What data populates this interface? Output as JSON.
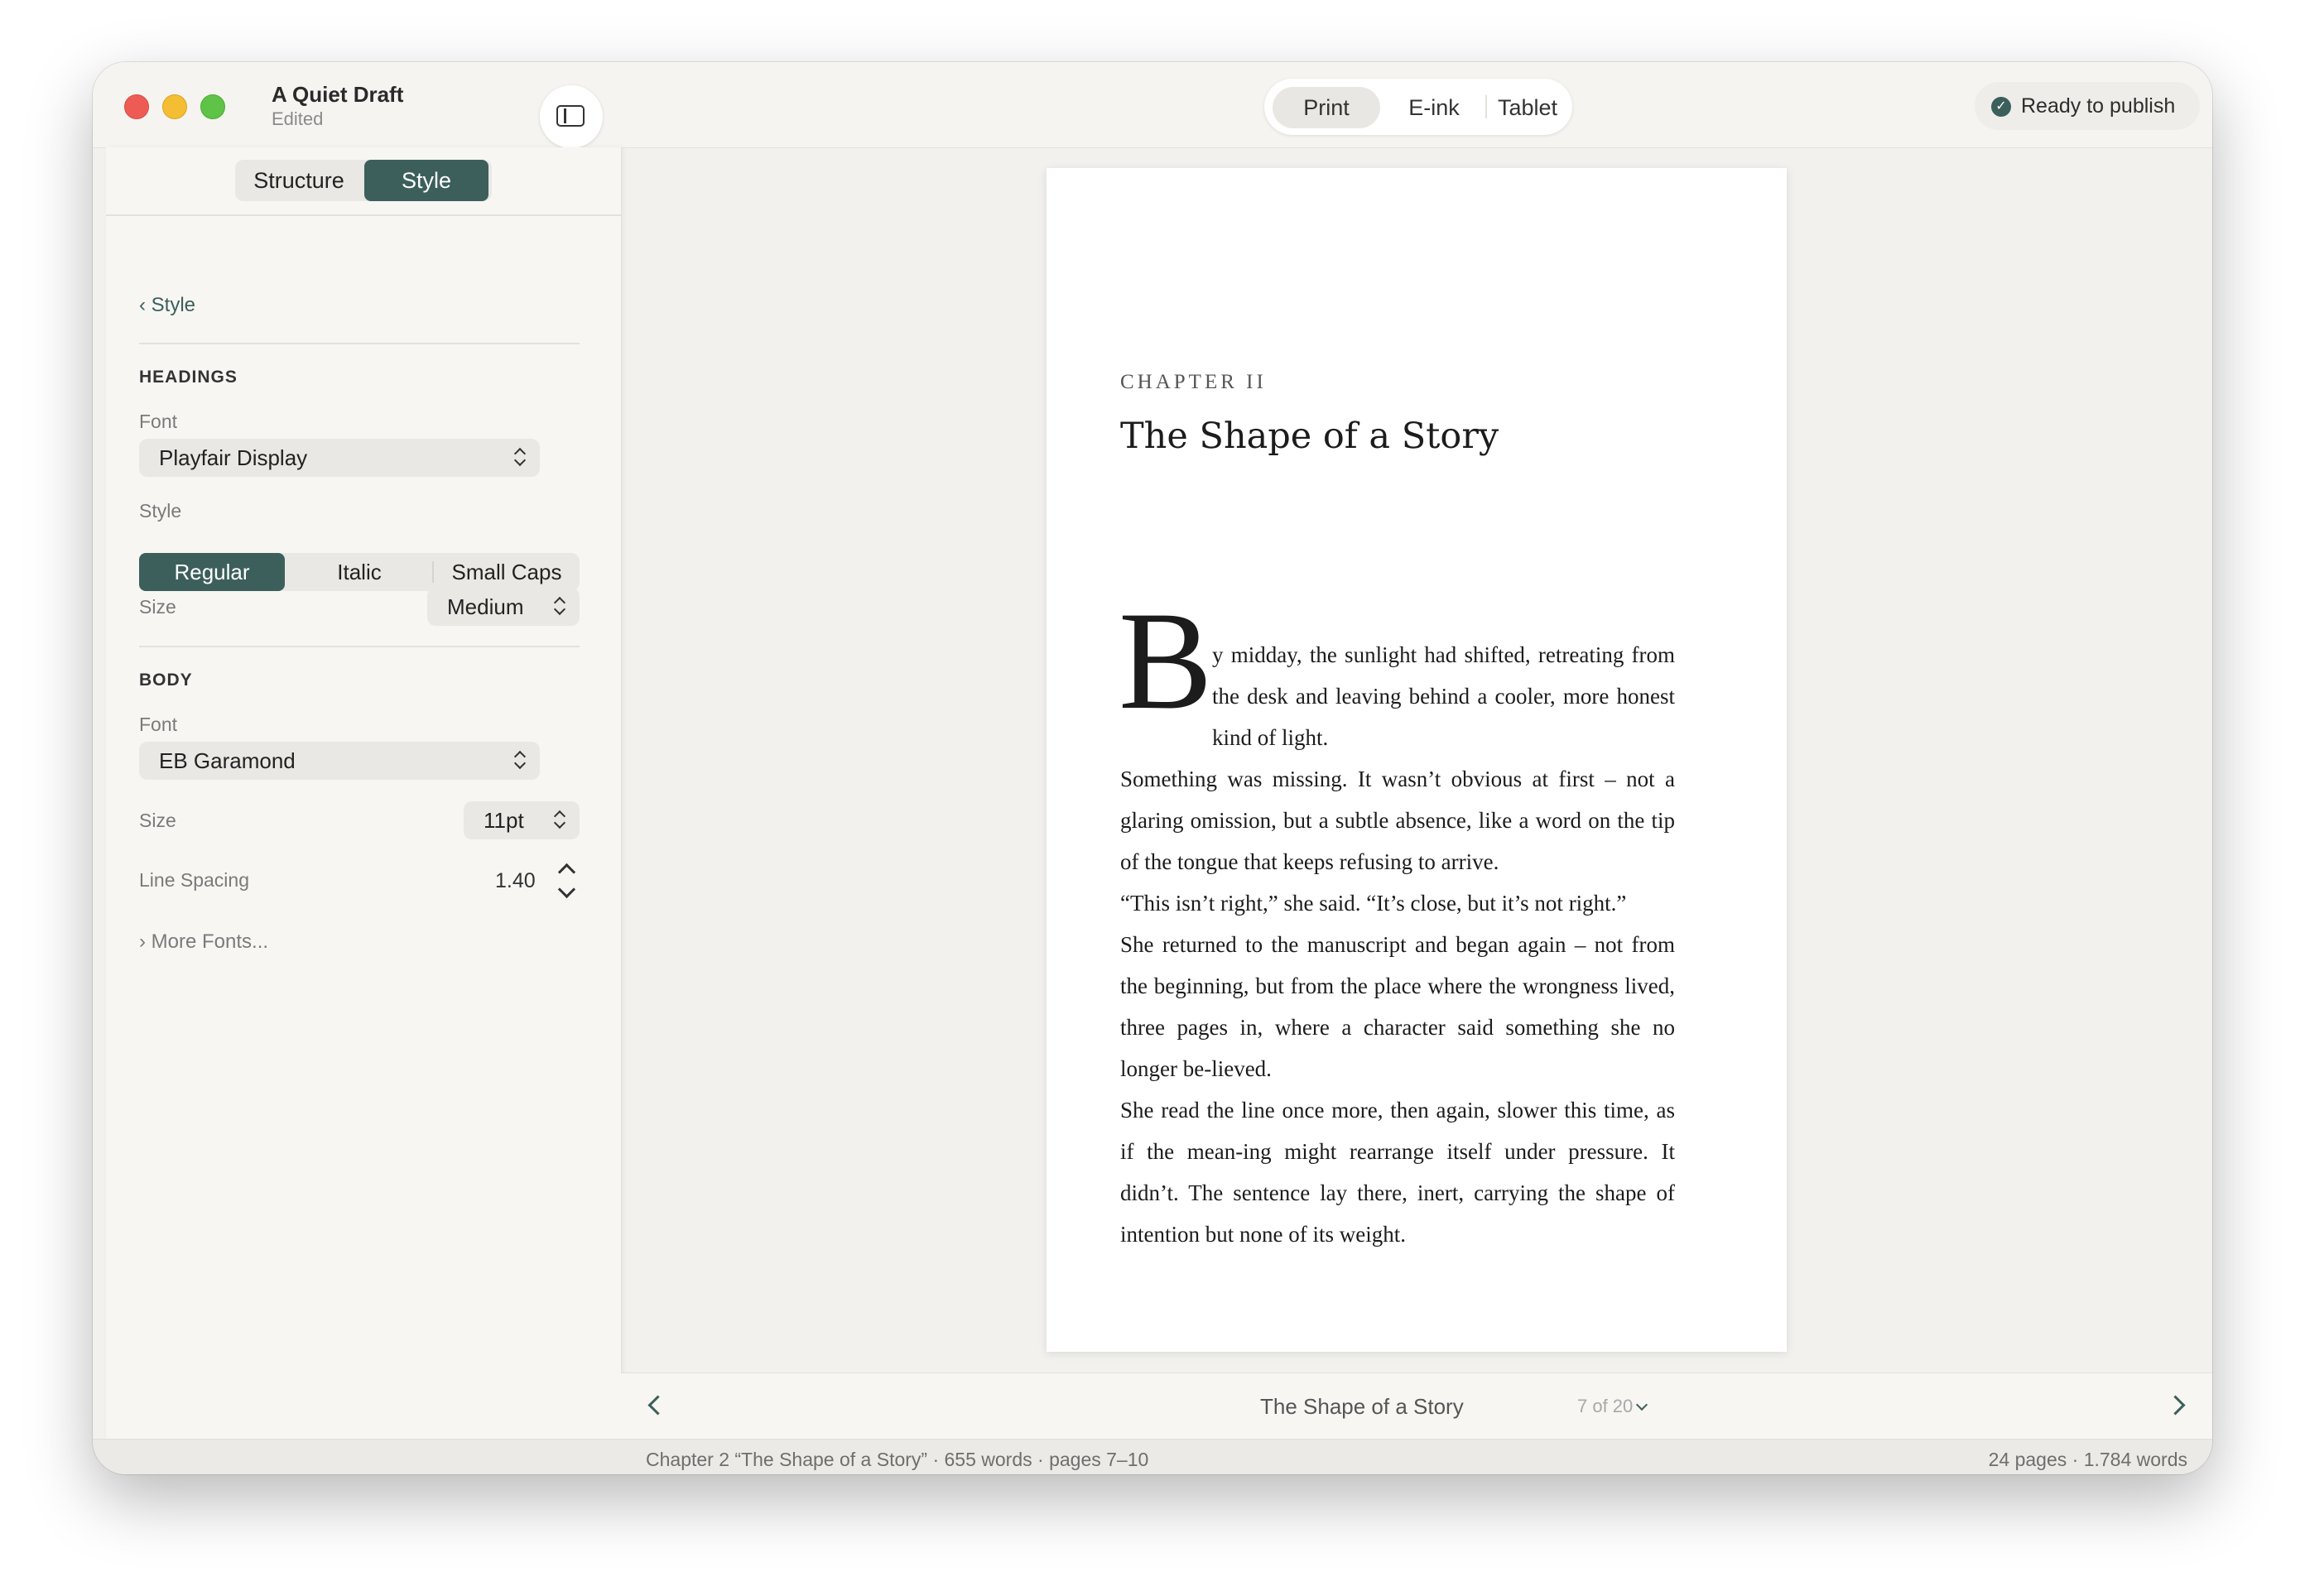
{
  "window": {
    "title": "A Quiet Draft",
    "subtitle": "Edited"
  },
  "toolbar": {
    "modes": [
      "Print",
      "E-ink",
      "Tablet"
    ],
    "active_mode": "Print",
    "publish_label": "Ready to publish"
  },
  "sidebar": {
    "tabs": [
      "Structure",
      "Style"
    ],
    "active_tab": "Style",
    "back_label": "Style",
    "headings": {
      "section_label": "HEADINGS",
      "font_label": "Font",
      "font_value": "Playfair Display",
      "style_label": "Style",
      "style_options": [
        "Regular",
        "Italic",
        "Small Caps"
      ],
      "style_active": "Regular",
      "size_label": "Size",
      "size_value": "Medium"
    },
    "body": {
      "section_label": "BODY",
      "font_label": "Font",
      "font_value": "EB Garamond",
      "size_label": "Size",
      "size_value": "11pt",
      "line_spacing_label": "Line Spacing",
      "line_spacing_value": "1.40"
    },
    "more_fonts": "More Fonts..."
  },
  "page": {
    "chapter_label": "CHAPTER II",
    "chapter_title": "The Shape of a Story",
    "drop_cap": "B",
    "first_paragraph": "y midday, the sunlight had shifted, retreating from the desk and leaving behind a cooler, more honest kind of light.",
    "paragraphs": [
      "Something was missing. It wasn’t obvious at first – not a glaring omission, but a subtle absence, like a word on the tip of the tongue that keeps refusing to arrive.",
      "“This isn’t right,” she said. “It’s close, but it’s not right.”",
      "She returned to the manuscript and began again – not from the beginning, but from the place where the wrongness lived, three pages in, where a character said something she no longer be-lieved.",
      "She read the line once more, then again, slower this time, as if the mean-ing might rearrange itself under pressure. It didn’t. The sentence lay there, inert, carrying the shape of intention but none of its weight."
    ]
  },
  "navigation": {
    "title": "The Shape of a Story",
    "page_indicator": "7 of 20"
  },
  "status": {
    "left": "Chapter 2 “The Shape of a Story”  ·  655 words  ·  pages 7–10",
    "right": "24 pages  ·  1.784 words"
  },
  "colors": {
    "accent": "#3c5f5b",
    "window_bg": "#f2f1ee",
    "sidebar_bg": "#f7f6f3"
  }
}
